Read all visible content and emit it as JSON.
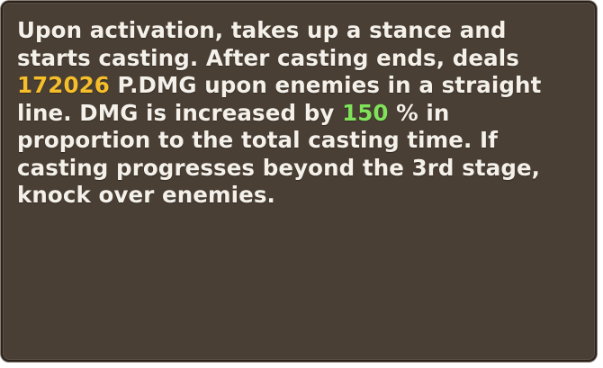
{
  "tooltip": {
    "text_part1": "Upon activation, takes up a stance and starts casting. After casting ends, deals ",
    "damage_value": "172026",
    "text_part2": " P.DMG upon enemies in a straight line. DMG is increased by ",
    "increase_value": "150",
    "text_part3": " % in proportion to the total casting time. If casting progresses beyond the 3rd stage, knock over enemies."
  },
  "colors": {
    "panel_background": "#4a3f34",
    "panel_border": "#2a231d",
    "text": "#f4f0ea",
    "damage_highlight": "#f5be2a",
    "increase_highlight": "#7fe25a"
  }
}
